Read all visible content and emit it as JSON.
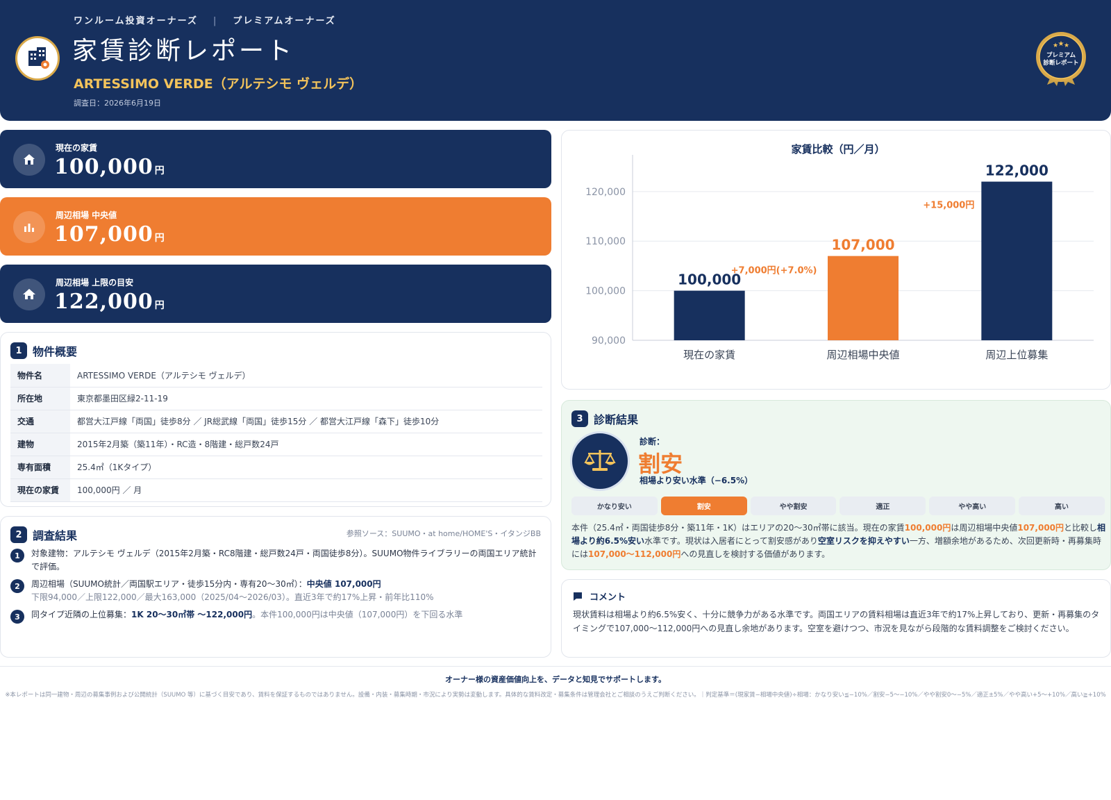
{
  "header": {
    "breadcrumb_1": "ワンルーム投資オーナーズ",
    "breadcrumb_sep": "|",
    "breadcrumb_2": "プレミアムオーナーズ",
    "title": "家賃診断レポート",
    "property": "ARTESSIMO VERDE（アルテシモ ヴェルデ）",
    "date": "調査日：2026年6月19日",
    "seal_line1": "プレミアム",
    "seal_line2": "診断レポート"
  },
  "kpis": [
    {
      "label": "現在の家賃",
      "value": "100,000",
      "unit": "円"
    },
    {
      "label": "周辺相場 中央値",
      "value": "107,000",
      "unit": "円"
    },
    {
      "label": "周辺相場 上限の目安",
      "value": "122,000",
      "unit": "円"
    }
  ],
  "overview": {
    "number": "1",
    "title": "物件概要",
    "rows": [
      {
        "key": "物件名",
        "value": "ARTESSIMO VERDE（アルテシモ ヴェルデ）"
      },
      {
        "key": "所在地",
        "value": "東京都墨田区緑2-11-19"
      },
      {
        "key": "交通",
        "value": "都営大江戸線「両国」徒歩8分 ／ JR総武線「両国」徒歩15分 ／ 都営大江戸線「森下」徒歩10分"
      },
      {
        "key": "建物",
        "value": "2015年2月築（築11年）・RC造・8階建・総戸数24戸"
      },
      {
        "key": "専有面積",
        "value": "25.4㎡（1Kタイプ）"
      },
      {
        "key": "現在の家賃",
        "value": "100,000円 ／ 月"
      }
    ]
  },
  "survey": {
    "number": "2",
    "title": "調査結果",
    "source": "参照ソース：SUUMO・at home/HOME'S・イタンジBB",
    "items": [
      {
        "n": "1",
        "text": "対象建物：アルテシモ ヴェルデ（2015年2月築・RC8階建・総戸数24戸・両国徒歩8分）。SUUMO物件ライブラリーの両国エリア統計で評価。"
      },
      {
        "n": "2",
        "text": "周辺相場（SUUMO統計／両国駅エリア・徒歩15分内・専有20〜30㎡）：",
        "bold": "中央値 107,000円",
        "sub": "下限94,000／上限122,000／最大163,000（2025/04〜2026/03）。直近3年で約17%上昇・前年比110%"
      },
      {
        "n": "3",
        "text": "同タイプ近隣の上位募集：",
        "bold": "1K 20〜30㎡帯 〜122,000円",
        "sub": "。本件100,000円は中央値（107,000円）を下回る水準"
      }
    ]
  },
  "chart_data": {
    "type": "bar",
    "title": "家賃比較（円／月）",
    "categories": [
      "現在の家賃",
      "周辺相場中央値",
      "周辺上位募集"
    ],
    "values": [
      100000,
      107000,
      122000
    ],
    "value_labels": [
      "100,000",
      "107,000",
      "122,000"
    ],
    "colors": [
      "#17305e",
      "#ef7d31",
      "#17305e"
    ],
    "yticks": [
      90000,
      100000,
      110000,
      120000
    ],
    "ytick_labels": [
      "90,000",
      "100,000",
      "110,000",
      "120,000"
    ],
    "ylim": [
      90000,
      126000
    ],
    "annotations": [
      "+7,000円(+7.0%)",
      "+15,000円"
    ],
    "grid": true,
    "xlabel": "",
    "ylabel": ""
  },
  "diagnosis": {
    "number": "3",
    "title": "診断結果",
    "label": "診断：",
    "verdict": "割安",
    "sub": "相場より安い水準（−6.5%）",
    "scale": [
      "かなり安い",
      "割安",
      "やや割安",
      "適正",
      "やや高い",
      "高い"
    ],
    "active_index": 1,
    "body_1": "本件（25.4㎡・両国徒歩8分・築11年・1K）はエリアの20〜30㎡帯に該当。現在の家賃",
    "body_o1": "100,000円",
    "body_2": "は周辺相場中央値",
    "body_o2": "107,000円",
    "body_3": "と比較し",
    "body_b1": "相場より約6.5%安い",
    "body_4": "水準です。現状は入居者にとって割安感があり",
    "body_b2": "空室リスクを抑えやすい",
    "body_5": "一方、増額余地があるため、次回更新時・再募集時には",
    "body_o3": "107,000〜112,000円",
    "body_6": "への見直しを検討する価値があります。"
  },
  "comment": {
    "title": "コメント",
    "body": "現状賃料は相場より約6.5%安く、十分に競争力がある水準です。両国エリアの賃料相場は直近3年で約17%上昇しており、更新・再募集のタイミングで107,000〜112,000円への見直し余地があります。空室を避けつつ、市況を見ながら段階的な賃料調整をご検討ください。"
  },
  "footer": {
    "tagline": "オーナー様の資産価値向上を、データと知見でサポートします。",
    "disclaimer": "※本レポートは同一建物・周辺の募集事例および公開統計（SUUMO 等）に基づく目安であり、賃料を保証するものではありません。設備・内装・募集時期・市況により実勢は変動します。具体的な賃料改定・募集条件は管理会社とご相談のうえご判断ください。｜判定基準＝(現家賃−相場中央値)÷相場：かなり安い≦−10%／割安−5〜−10%／やや割安0〜−5%／適正±5%／やや高い+5〜+10%／高い≧+10%"
  },
  "colors": {
    "navy": "#17305e",
    "orange": "#ef7d31",
    "gold": "#f3c35b",
    "diag_bg": "#eef7f0"
  },
  "icons": [
    "building-icon",
    "house-icon",
    "bar-chart-icon",
    "home-icon",
    "scale-icon",
    "comment-icon",
    "award-seal-icon"
  ]
}
